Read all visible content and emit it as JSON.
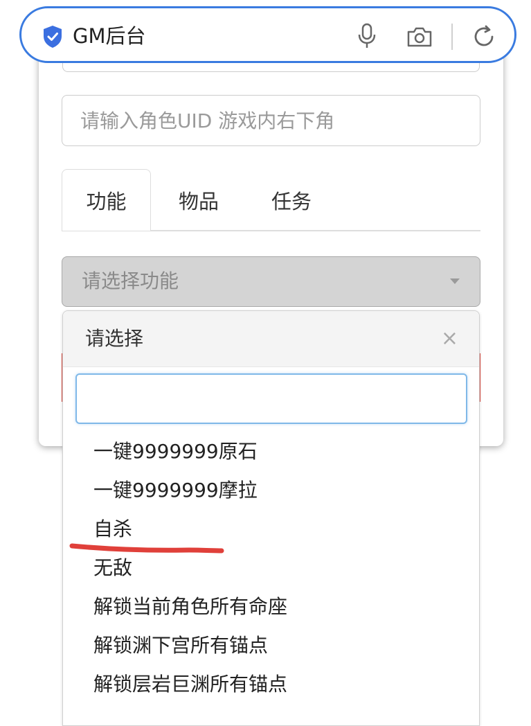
{
  "browser": {
    "site_title": "GM后台",
    "icons": [
      "shield-check-icon",
      "microphone-icon",
      "camera-icon",
      "refresh-icon"
    ],
    "accent_color": "#3a7be0"
  },
  "form": {
    "uid_placeholder": "请输入角色UID 游戏内右下角",
    "tabs": [
      {
        "label": "功能",
        "active": true
      },
      {
        "label": "物品",
        "active": false
      },
      {
        "label": "任务",
        "active": false
      }
    ],
    "select": {
      "placeholder": "请选择功能"
    }
  },
  "dropdown": {
    "title": "请选择",
    "close_label": "×",
    "search_value": "",
    "options": [
      "一键9999999原石",
      "一键9999999摩拉",
      "自杀",
      "无敌",
      "解锁当前角色所有命座",
      "解锁渊下宫所有锚点",
      "解锁层岩巨渊所有锚点"
    ]
  },
  "annotation": {
    "underlined_option": "自杀",
    "color": "#e0403a"
  }
}
